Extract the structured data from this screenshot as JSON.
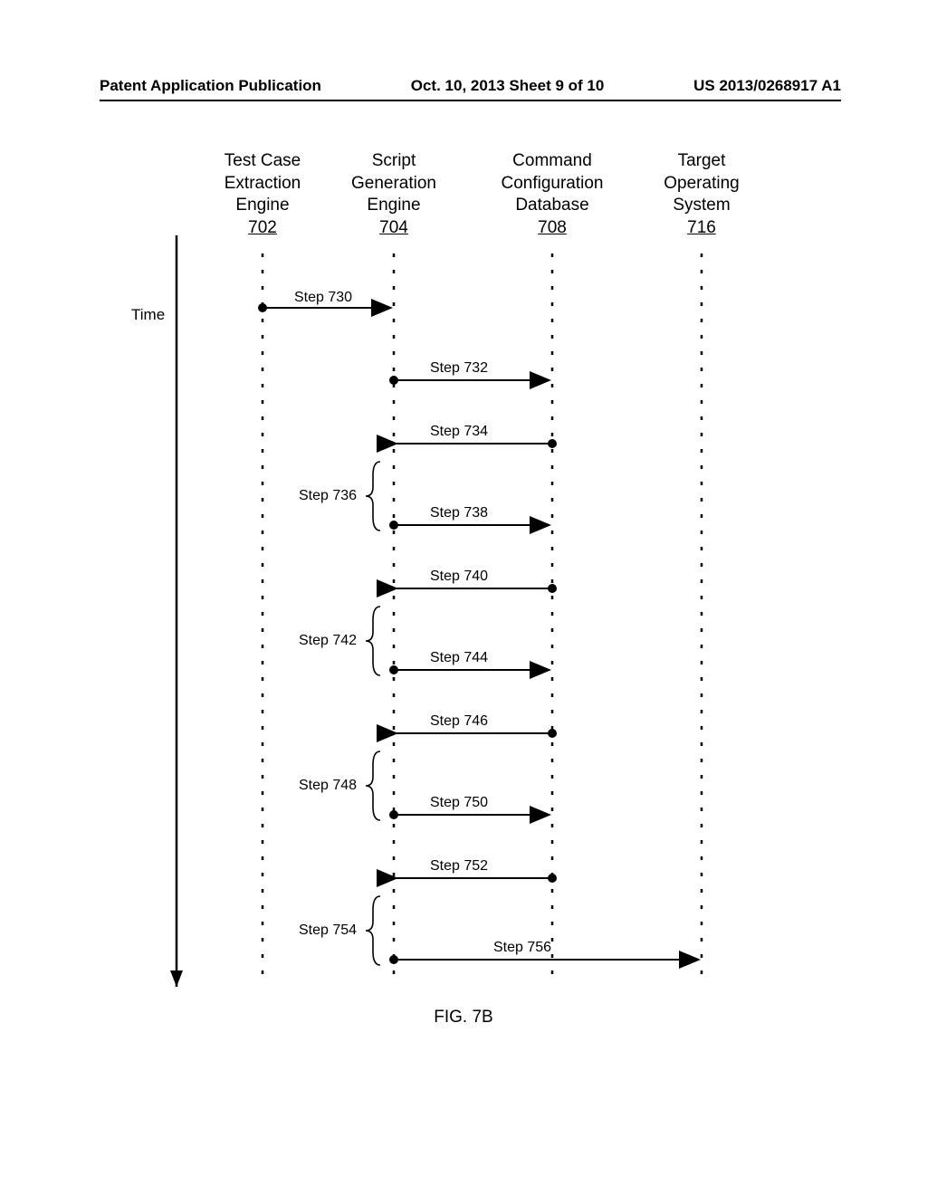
{
  "header": {
    "left": "Patent Application Publication",
    "center": "Oct. 10, 2013  Sheet 9 of 10",
    "right": "US 2013/0268917 A1"
  },
  "time_axis_label": "Time",
  "figure_label": "FIG. 7B",
  "participants": [
    {
      "title": "Test Case\nExtraction\nEngine",
      "ref": "702"
    },
    {
      "title": "Script\nGeneration\nEngine",
      "ref": "704"
    },
    {
      "title": "Command\nConfiguration\nDatabase",
      "ref": "708"
    },
    {
      "title": "Target\nOperating\nSystem",
      "ref": "716"
    }
  ],
  "messages": [
    {
      "label": "Step 730",
      "from": 0,
      "to": 1
    },
    {
      "label": "Step 732",
      "from": 1,
      "to": 2
    },
    {
      "label": "Step 734",
      "from": 2,
      "to": 1
    },
    {
      "group": "Step 736",
      "items": [
        {
          "label": "Step 738",
          "from": 1,
          "to": 2
        },
        {
          "label": "Step 740",
          "from": 2,
          "to": 1
        }
      ]
    },
    {
      "group": "Step 742",
      "items": [
        {
          "label": "Step 744",
          "from": 1,
          "to": 2
        },
        {
          "label": "Step 746",
          "from": 2,
          "to": 1
        }
      ]
    },
    {
      "group": "Step 748",
      "items": [
        {
          "label": "Step 750",
          "from": 1,
          "to": 2
        },
        {
          "label": "Step 752",
          "from": 2,
          "to": 1
        }
      ]
    },
    {
      "group": "Step 754",
      "items": [
        {
          "label": "Step 756",
          "from": 1,
          "to": 3
        }
      ]
    }
  ],
  "chart_data": {
    "type": "sequence-diagram",
    "title": "FIG. 7B",
    "participants": [
      "Test Case Extraction Engine 702",
      "Script Generation Engine 704",
      "Command Configuration Database 708",
      "Target Operating System 716"
    ],
    "time_axis": "vertical-down",
    "arrows": [
      {
        "step": "Step 730",
        "from": "702",
        "to": "704"
      },
      {
        "step": "Step 732",
        "from": "704",
        "to": "708"
      },
      {
        "step": "Step 734",
        "from": "708",
        "to": "704"
      },
      {
        "group": "Step 736",
        "steps": [
          {
            "step": "Step 738",
            "from": "704",
            "to": "708"
          },
          {
            "step": "Step 740",
            "from": "708",
            "to": "704"
          }
        ]
      },
      {
        "group": "Step 742",
        "steps": [
          {
            "step": "Step 744",
            "from": "704",
            "to": "708"
          },
          {
            "step": "Step 746",
            "from": "708",
            "to": "704"
          }
        ]
      },
      {
        "group": "Step 748",
        "steps": [
          {
            "step": "Step 750",
            "from": "704",
            "to": "708"
          },
          {
            "step": "Step 752",
            "from": "708",
            "to": "704"
          }
        ]
      },
      {
        "group": "Step 754",
        "steps": [
          {
            "step": "Step 756",
            "from": "704",
            "to": "716"
          }
        ]
      }
    ]
  }
}
